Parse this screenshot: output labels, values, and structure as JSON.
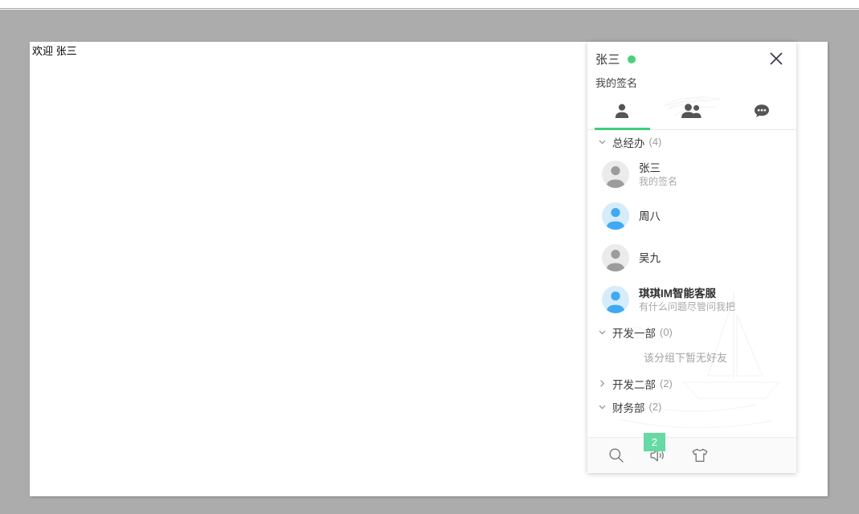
{
  "page": {
    "welcome_text": "欢迎 张三",
    "background_color": "#acacac",
    "panel_color": "#ffffff"
  },
  "im": {
    "header": {
      "username": "张三",
      "status": "online",
      "status_color": "#4bd07e",
      "signature": "我的签名",
      "close_label": "×"
    },
    "tabs": [
      {
        "name": "contacts",
        "icon": "person-icon",
        "active": true
      },
      {
        "name": "groups",
        "icon": "people-icon",
        "active": false
      },
      {
        "name": "chats",
        "icon": "chat-bubble-icon",
        "active": false
      }
    ],
    "accent_color": "#3ecf7a",
    "groups": [
      {
        "name": "总经办",
        "count": "(4)",
        "expanded": true,
        "empty_text": "",
        "contacts": [
          {
            "name": "张三",
            "signature": "我的签名",
            "status": "offline",
            "bold": false
          },
          {
            "name": "周八",
            "signature": "",
            "status": "online",
            "bold": false
          },
          {
            "name": "吴九",
            "signature": "",
            "status": "offline",
            "bold": false
          },
          {
            "name": "琪琪IM智能客服",
            "signature": "有什么问题尽管问我把",
            "status": "online",
            "bold": true
          }
        ]
      },
      {
        "name": "开发一部",
        "count": "(0)",
        "expanded": true,
        "empty_text": "该分组下暂无好友",
        "contacts": []
      },
      {
        "name": "开发二部",
        "count": "(2)",
        "expanded": false,
        "empty_text": "",
        "contacts": []
      },
      {
        "name": "财务部",
        "count": "(2)",
        "expanded": true,
        "empty_text": "",
        "contacts": []
      }
    ],
    "toolbar": [
      {
        "name": "search",
        "icon": "search-icon"
      },
      {
        "name": "sound",
        "icon": "speaker-icon"
      },
      {
        "name": "skin",
        "icon": "tshirt-icon"
      }
    ],
    "badge": {
      "count": "2",
      "color": "#66d9a4"
    }
  }
}
